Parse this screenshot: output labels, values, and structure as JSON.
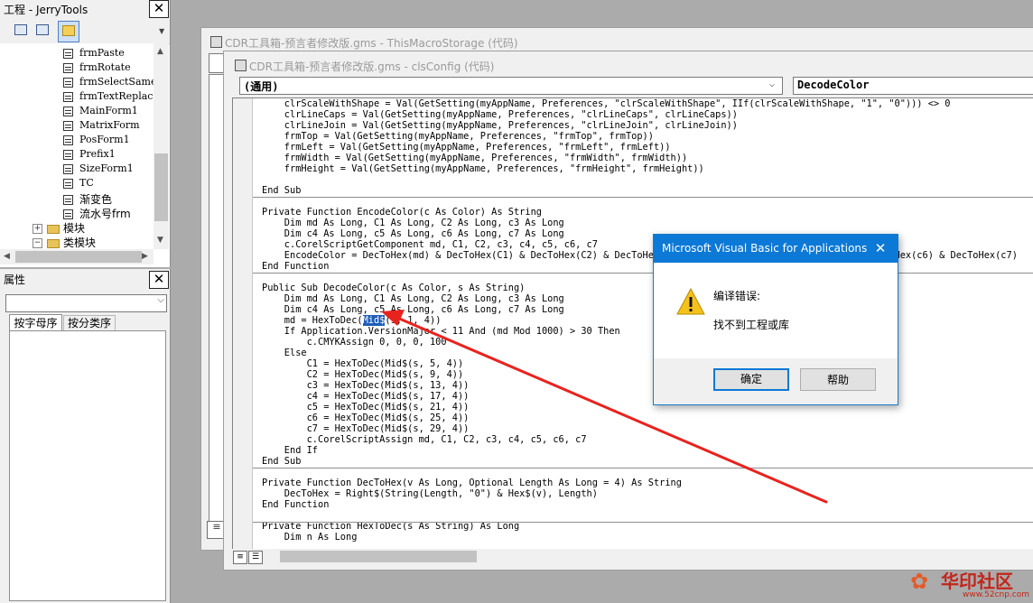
{
  "project_explorer": {
    "title": "工程 - JerryTools",
    "close_glyph": "✕",
    "items": [
      {
        "label": "frmPaste"
      },
      {
        "label": "frmRotate"
      },
      {
        "label": "frmSelectSame"
      },
      {
        "label": "frmTextReplac"
      },
      {
        "label": "MainForm1"
      },
      {
        "label": "MatrixForm"
      },
      {
        "label": "PosForm1"
      },
      {
        "label": "Prefix1"
      },
      {
        "label": "SizeForm1"
      },
      {
        "label": "TC"
      },
      {
        "label": "渐变色"
      },
      {
        "label": "流水号frm"
      }
    ],
    "folders": [
      {
        "expander": "+",
        "label": "模块"
      },
      {
        "expander": "−",
        "label": "类模块"
      }
    ]
  },
  "properties": {
    "title": "属性",
    "close_glyph": "✕",
    "tabs": [
      "按字母序",
      "按分类序"
    ]
  },
  "back_window": {
    "title": "CDR工具箱-预言者修改版.gms - ThisMacroStorage (代码)"
  },
  "front_window": {
    "title": "CDR工具箱-预言者修改版.gms - clsConfig (代码)",
    "object_combo": "(通用)",
    "proc_combo": "DecodeColor",
    "code_blocks": [
      {
        "lines": [
          "    clrScaleWithShape = Val(GetSetting(myAppName, Preferences, \"clrScaleWithShape\", IIf(clrScaleWithShape, \"1\", \"0\"))) <> 0",
          "    clrLineCaps = Val(GetSetting(myAppName, Preferences, \"clrLineCaps\", clrLineCaps))",
          "    clrLineJoin = Val(GetSetting(myAppName, Preferences, \"clrLineJoin\", clrLineJoin))",
          "    frmTop = Val(GetSetting(myAppName, Preferences, \"frmTop\", frmTop))",
          "    frmLeft = Val(GetSetting(myAppName, Preferences, \"frmLeft\", frmLeft))",
          "    frmWidth = Val(GetSetting(myAppName, Preferences, \"frmWidth\", frmWidth))",
          "    frmHeight = Val(GetSetting(myAppName, Preferences, \"frmHeight\", frmHeight))",
          "",
          "End Sub"
        ]
      },
      {
        "lines": [
          "Private Function EncodeColor(c As Color) As String",
          "    Dim md As Long, C1 As Long, C2 As Long, c3 As Long",
          "    Dim c4 As Long, c5 As Long, c6 As Long, c7 As Long",
          "    c.CorelScriptGetComponent md, C1, C2, c3, c4, c5, c6, c7",
          "    EncodeColor = DecToHex(md) & DecToHex(C1) & DecToHex(C2) & DecToHex(c3) & DecToHex(c4) & DecToHex(c5) & DecToHex(c6) & DecToHex(c7)",
          "End Function"
        ]
      },
      {
        "lines_before": [
          "Public Sub DecodeColor(c As Color, s As String)",
          "    Dim md As Long, C1 As Long, C2 As Long, c3 As Long",
          "    Dim c4 As Long, c5 As Long, c6 As Long, c7 As Long"
        ],
        "hl_prefix": "    md = HexToDec(",
        "hl_word": "Mid$",
        "hl_suffix": "(s, 1, 4))",
        "lines_after": [
          "    If Application.VersionMajor < 11 And (md Mod 1000) > 30 Then",
          "        c.CMYKAssign 0, 0, 0, 100",
          "    Else",
          "        C1 = HexToDec(Mid$(s, 5, 4))",
          "        C2 = HexToDec(Mid$(s, 9, 4))",
          "        c3 = HexToDec(Mid$(s, 13, 4))",
          "        c4 = HexToDec(Mid$(s, 17, 4))",
          "        c5 = HexToDec(Mid$(s, 21, 4))",
          "        c6 = HexToDec(Mid$(s, 25, 4))",
          "        c7 = HexToDec(Mid$(s, 29, 4))",
          "        c.CorelScriptAssign md, C1, C2, c3, c4, c5, c6, c7",
          "    End If",
          "End Sub"
        ]
      },
      {
        "lines": [
          "Private Function DecToHex(v As Long, Optional Length As Long = 4) As String",
          "    DecToHex = Right$(String(Length, \"0\") & Hex$(v), Length)",
          "End Function"
        ]
      },
      {
        "lines": [
          "Private Function HexToDec(s As String) As Long",
          "    Dim n As Long"
        ]
      }
    ]
  },
  "dialog": {
    "title": "Microsoft Visual Basic for Applications",
    "close_glyph": "✕",
    "message_title": "编译错误:",
    "message": "找不到工程或库",
    "ok_label": "确定",
    "help_label": "帮助"
  },
  "watermark": {
    "text": "华印社区",
    "url": "www.52cnp.com"
  },
  "colors": {
    "dialog_accent": "#0c79d6",
    "selection": "#1e5db7",
    "annotation_arrow": "#e8231e",
    "watermark": "#c2261b"
  }
}
